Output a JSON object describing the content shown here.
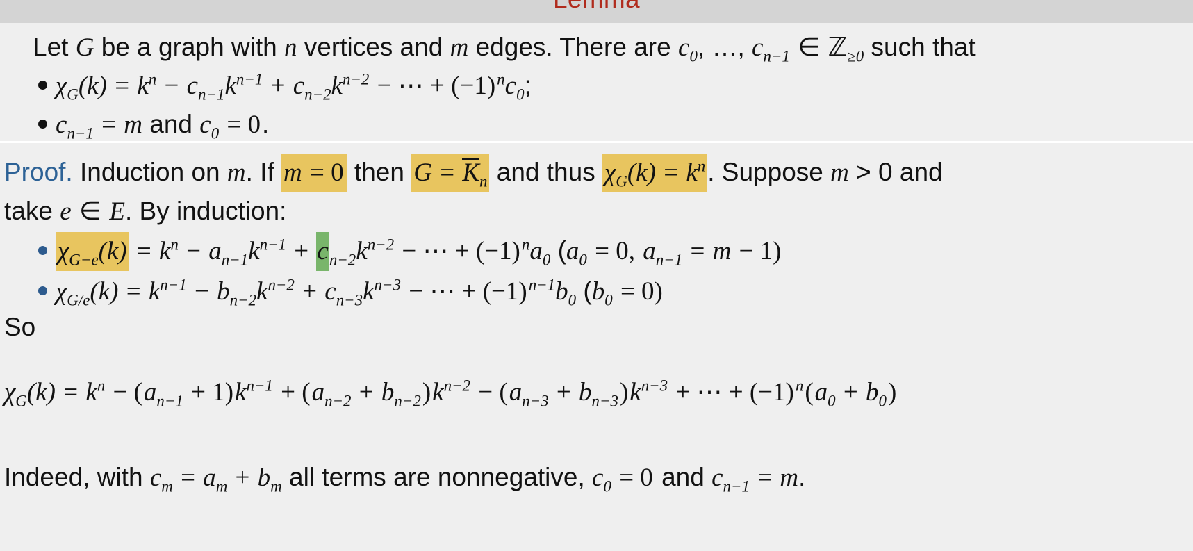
{
  "slide": {
    "background_color": "#efefef",
    "header_band_color": "#d4d4d4",
    "title": "Lemma",
    "title_color": "#b02b1d",
    "proof_label_color": "#2d6296",
    "highlight_gold": "#e8c55f",
    "highlight_green": "#79b56b"
  },
  "lemma": {
    "intro": {
      "t1": "Let ",
      "G": "G",
      "t2": " be a graph with ",
      "n": "n",
      "t3": " vertices and ",
      "m": "m",
      "t4": " edges. There are ",
      "c": "c",
      "sub0": "0",
      "t5": ", …, ",
      "c2": "c",
      "subn1": "n−1",
      "in": " ∈ ",
      "Z": "ℤ",
      "subge0": "≥0",
      "t6": " such that"
    },
    "bullets": [
      {
        "chi": "χ",
        "chi_sub": "G",
        "arg": "(k)",
        "eq": " = ",
        "k1": "k",
        "k1sup": "n",
        "minus": " − ",
        "c1": "c",
        "c1sub": "n−1",
        "k2": "k",
        "k2sup": "n−1",
        "plus": " + ",
        "c2": "c",
        "c2sub": "n−2",
        "k3": "k",
        "k3sup": "n−2",
        "tail": " − ⋯ + (−1)",
        "tailsup": "n",
        "c0": "c",
        "c0sub": "0",
        "end": ";"
      },
      {
        "c1": "c",
        "c1sub": "n−1",
        "eq": " = ",
        "m": "m",
        "and": " and ",
        "c0": "c",
        "c0sub": "0",
        "eq2": " = 0",
        "end": "."
      }
    ]
  },
  "proof": {
    "label": "Proof.",
    "line1": {
      "t1": " Induction on ",
      "m": "m",
      "t2": ". If ",
      "hl1_m": "m",
      "hl1_eq": " = 0",
      "t3": " then ",
      "hl2_G": "G",
      "hl2_eq": " = ",
      "hl2_K": "K",
      "hl2_Ksub": "n",
      "t4": " and thus ",
      "hl3_chi": "χ",
      "hl3_chisub": "G",
      "hl3_arg": "(k)",
      "hl3_eq": " = ",
      "hl3_k": "k",
      "hl3_ksup": "n",
      "t5": ". Suppose ",
      "m2": "m",
      "t6": " > 0 and"
    },
    "line2": {
      "t1": "take ",
      "e": "e",
      "in": " ∈ ",
      "E": "E",
      "t2": ". By induction:"
    },
    "bullets": [
      {
        "chi": "χ",
        "chi_sub": "G−e",
        "arg": "(k)",
        "eq": " = ",
        "k1": "k",
        "k1sup": "n",
        "minus": " − ",
        "a1": "a",
        "a1sub": "n−1",
        "k2": "k",
        "k2sup": "n−1",
        "plus": " + ",
        "c_hl": "c",
        "c_sub": "n−2",
        "k3": "k",
        "k3sup": "n−2",
        "tail": " − ⋯ + (−1)",
        "tailsup": "n",
        "a0": "a",
        "a0sub": "0",
        "paren_open": "   (",
        "p_a0": "a",
        "p_a0sub": "0",
        "p_eq0": " = 0, ",
        "p_a": "a",
        "p_asub": "n−1",
        "p_eq": " = ",
        "p_m": "m",
        "p_minus1": " − 1)"
      },
      {
        "chi": "χ",
        "chi_sub": "G/e",
        "arg": "(k)",
        "eq": " = ",
        "k1": "k",
        "k1sup": "n−1",
        "minus": " − ",
        "b1": "b",
        "b1sub": "n−2",
        "k2": "k",
        "k2sup": "n−2",
        "plus": " + ",
        "c1": "c",
        "c1sub": "n−3",
        "k3": "k",
        "k3sup": "n−3",
        "tail": " − ⋯ + (−1)",
        "tailsup": "n−1",
        "b0": "b",
        "b0sub": "0",
        "paren_open": "   (",
        "p_b0": "b",
        "p_b0sub": "0",
        "p_eq": " = 0)"
      }
    ],
    "so": "So",
    "display": {
      "chi": "χ",
      "chi_sub": "G",
      "arg": "(k)",
      "eq": " = ",
      "k1": "k",
      "k1sup": "n",
      "t1": " − (",
      "a1": "a",
      "a1sub": "n−1",
      "t2": " + 1)",
      "k2": "k",
      "k2sup": "n−1",
      "t3": " + (",
      "a2": "a",
      "a2sub": "n−2",
      "t4": " + ",
      "b2": "b",
      "b2sub": "n−2",
      "t5": ")",
      "k3": "k",
      "k3sup": "n−2",
      "t6": " − (",
      "a3": "a",
      "a3sub": "n−3",
      "t7": " + ",
      "b3": "b",
      "b3sub": "n−3",
      "t8": ")",
      "k4": "k",
      "k4sup": "n−3",
      "t9": " + ⋯ + (−1)",
      "t9sup": "n",
      "t10": "(",
      "a0": "a",
      "a0sub": "0",
      "t11": " + ",
      "b0": "b",
      "b0sub": "0",
      "t12": ")"
    },
    "indeed": {
      "t1": "Indeed, with ",
      "c": "c",
      "csub": "m",
      "eq": " = ",
      "a": "a",
      "asub": "m",
      "plus": " + ",
      "b": "b",
      "bsub": "m",
      "t2": " all terms are nonnegative, ",
      "c0": "c",
      "c0sub": "0",
      "eq0": " = 0",
      "and": " and ",
      "cn": "c",
      "cnsub": "n−1",
      "eqm": " = ",
      "m": "m",
      "end": "."
    }
  }
}
